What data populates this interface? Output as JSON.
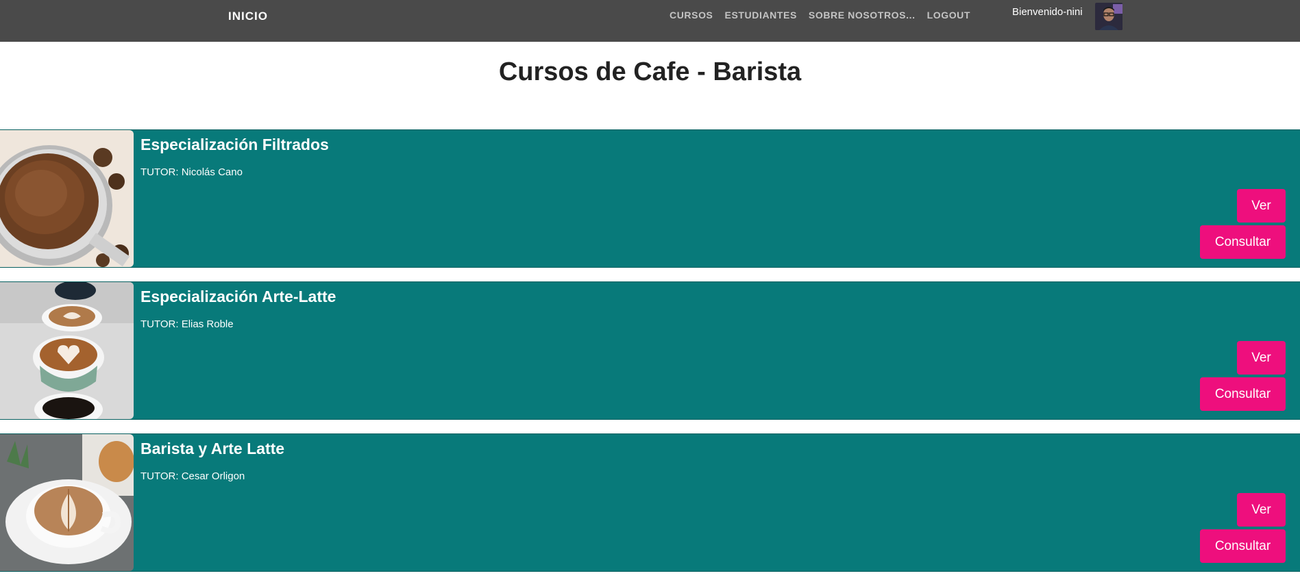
{
  "nav": {
    "brand": "INICIO",
    "links": [
      "CURSOS",
      "ESTUDIANTES",
      "SOBRE NOSOTROS...",
      "LOGOUT"
    ],
    "welcome": "Bienvenido-nini"
  },
  "page": {
    "title": "Cursos de Cafe - Barista"
  },
  "courses": [
    {
      "title": "Especialización Filtrados",
      "tutor": "TUTOR: Nicolás Cano",
      "ver_label": "Ver",
      "consultar_label": "Consultar"
    },
    {
      "title": "Especialización Arte-Latte",
      "tutor": "TUTOR: Elias Roble",
      "ver_label": "Ver",
      "consultar_label": "Consultar"
    },
    {
      "title": "Barista y Arte Latte",
      "tutor": "TUTOR: Cesar Orligon",
      "ver_label": "Ver",
      "consultar_label": "Consultar"
    }
  ],
  "colors": {
    "navbar": "#4a4a4a",
    "card": "#087a7a",
    "button": "#ee0f7d"
  }
}
